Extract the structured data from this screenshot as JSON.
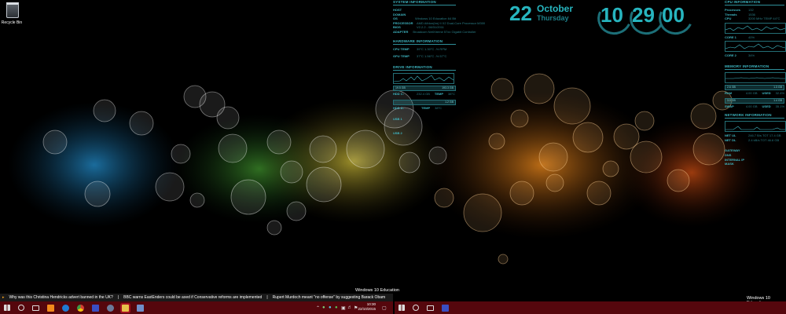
{
  "desktop": {
    "recycle_bin_label": "Recycle Bin"
  },
  "system_info": {
    "header": "SYSTEM INFORMATION",
    "rows": [
      {
        "k": "HOST",
        "v": ""
      },
      {
        "k": "DOMAIN",
        "v": ""
      },
      {
        "k": "OS",
        "v": "Windows 10 Education 64 Bit"
      },
      {
        "k": "PROCESSOR",
        "v": "AMD Athlon(tm) II X2 Dual-Core Processor M300"
      },
      {
        "k": "BIOS",
        "v": "V2.2.2 - 08/31/2011"
      },
      {
        "k": "ADAPTER",
        "v": "Broadcom NetXtreme 57xx Gigabit Controller"
      }
    ]
  },
  "hardware_info": {
    "header": "HARDWARE INFORMATION",
    "rows": [
      {
        "k": "CPU TEMP",
        "v": "39°C  1.30°C  -% RPM"
      },
      {
        "k": "GPU TEMP",
        "v": "37°C  1.56°C  -% 57°C"
      }
    ]
  },
  "drive_info": {
    "header": "DRIVE INFORMATION",
    "drives": [
      {
        "label": "HDD C:",
        "size": "232.4 GB",
        "temp_label": "TEMP",
        "temp": "38°C",
        "bar_left": "19.5 GB",
        "bar_right": "193.3 GB"
      },
      {
        "label": "HDD D:",
        "size": "",
        "temp_label": "TEMP",
        "temp": "38°C",
        "bar_left": "",
        "bar_right": "1.2 GB"
      },
      {
        "label": "USB 1",
        "size": "",
        "temp_label": "",
        "temp": "",
        "bar_left": "",
        "bar_right": ""
      },
      {
        "label": "USB 2",
        "size": "",
        "temp_label": "",
        "temp": "",
        "bar_left": "",
        "bar_right": ""
      }
    ]
  },
  "date": {
    "day": "22",
    "month": "October",
    "weekday": "Thursday"
  },
  "clock": {
    "hours": "10",
    "minutes": "29",
    "seconds": "00"
  },
  "cpu_info": {
    "header": "CPU INFORMATION",
    "rows": [
      {
        "k": "Processes",
        "v": "132"
      },
      {
        "k": "Threads",
        "v": "1536"
      },
      {
        "k": "CPU",
        "v": "3200 MHz   TEMP 44°C"
      }
    ],
    "core1": "CORE 1",
    "core1_val": "40%",
    "core2": "CORE 2",
    "core2_val": "34%"
  },
  "memory_info": {
    "header": "MEMORY INFORMATION",
    "ram": {
      "label": "RAM",
      "total": "4.00 GB",
      "used_label": "USED",
      "used": "32.4%",
      "bar_left": "2.6 GB",
      "bar_right": "1.3 GB"
    },
    "swap": {
      "label": "SWAP",
      "total": "4.00 GB",
      "used_label": "USED",
      "used": "35.1%",
      "bar_left": "3.0 GB",
      "bar_right": "1.4 GB"
    }
  },
  "network_info": {
    "header": "NETWORK INFORMATION",
    "rows": [
      {
        "k": "NET UL",
        "v": "246.7 B/s   TOT 17.4 GB"
      },
      {
        "k": "NET DL",
        "v": "2.4 kB/s    TOT 46.6 GB"
      }
    ],
    "labels": [
      "GATEWAY",
      "DNS",
      "INTERNAL IP",
      "MASK"
    ]
  },
  "watermarks": {
    "left": "Windows 10 Education",
    "right": "Windows 10 Education"
  },
  "news_ticker": {
    "items": [
      "Why was this Christina Hendricks advert banned in the UK?",
      "BBC warns EastEnders could be axed if Conservative reforms are implemented",
      "Rupert Murdoch meant \"no offense\" by suggesting Barack Obam"
    ],
    "separator": "|"
  },
  "taskbar": {
    "time": "10:30",
    "date": "22/10/2015",
    "accent": "#55070d",
    "active": "#a31020"
  }
}
